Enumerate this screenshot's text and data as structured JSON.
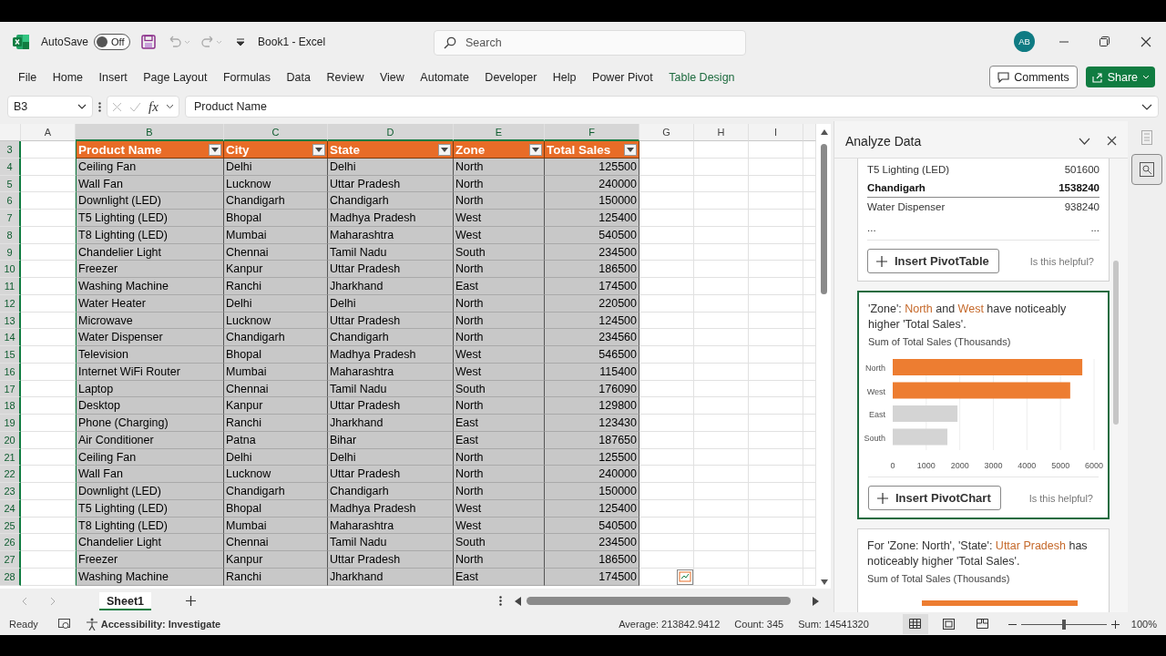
{
  "title_bar": {
    "autosave": {
      "label": "AutoSave",
      "on": false,
      "state_text": "Off"
    },
    "document_title": "Book1  -  Excel",
    "search": {
      "placeholder": "Search"
    },
    "avatar": "AB"
  },
  "ribbon": {
    "tabs": [
      {
        "label": "File",
        "contextual": false
      },
      {
        "label": "Home",
        "contextual": false
      },
      {
        "label": "Insert",
        "contextual": false
      },
      {
        "label": "Page Layout",
        "contextual": false
      },
      {
        "label": "Formulas",
        "contextual": false
      },
      {
        "label": "Data",
        "contextual": false
      },
      {
        "label": "Review",
        "contextual": false
      },
      {
        "label": "View",
        "contextual": false
      },
      {
        "label": "Automate",
        "contextual": false
      },
      {
        "label": "Developer",
        "contextual": false
      },
      {
        "label": "Help",
        "contextual": false
      },
      {
        "label": "Power Pivot",
        "contextual": false
      },
      {
        "label": "Table Design",
        "contextual": true
      }
    ],
    "comments": "Comments",
    "share": "Share"
  },
  "formula_bar": {
    "name_box": "B3",
    "fx": "fx",
    "formula": "Product Name"
  },
  "grid": {
    "columns": [
      {
        "letter": "A",
        "selected": false
      },
      {
        "letter": "B",
        "selected": true
      },
      {
        "letter": "C",
        "selected": true
      },
      {
        "letter": "D",
        "selected": true
      },
      {
        "letter": "E",
        "selected": true
      },
      {
        "letter": "F",
        "selected": true
      },
      {
        "letter": "G",
        "selected": false
      },
      {
        "letter": "H",
        "selected": false
      },
      {
        "letter": "I",
        "selected": false
      }
    ],
    "header_row": {
      "number": "3",
      "selected": true
    },
    "table_columns": [
      {
        "label": "Product Name"
      },
      {
        "label": "City"
      },
      {
        "label": "State"
      },
      {
        "label": "Zone"
      },
      {
        "label": "Total Sales"
      }
    ],
    "rows": [
      {
        "number": "4",
        "selected": true,
        "cells": [
          "Ceiling Fan",
          "Delhi",
          "Delhi",
          "North",
          "125500"
        ]
      },
      {
        "number": "5",
        "selected": true,
        "cells": [
          "Wall Fan",
          "Lucknow",
          "Uttar Pradesh",
          "North",
          "240000"
        ]
      },
      {
        "number": "6",
        "selected": true,
        "cells": [
          "Downlight (LED)",
          "Chandigarh",
          "Chandigarh",
          "North",
          "150000"
        ]
      },
      {
        "number": "7",
        "selected": true,
        "cells": [
          "T5 Lighting (LED)",
          "Bhopal",
          "Madhya Pradesh",
          "West",
          "125400"
        ]
      },
      {
        "number": "8",
        "selected": true,
        "cells": [
          "T8 Lighting (LED)",
          "Mumbai",
          "Maharashtra",
          "West",
          "540500"
        ]
      },
      {
        "number": "9",
        "selected": true,
        "cells": [
          "Chandelier Light",
          "Chennai",
          "Tamil Nadu",
          "South",
          "234500"
        ]
      },
      {
        "number": "10",
        "selected": true,
        "cells": [
          "Freezer",
          "Kanpur",
          "Uttar Pradesh",
          "North",
          "186500"
        ]
      },
      {
        "number": "11",
        "selected": true,
        "cells": [
          "Washing Machine",
          "Ranchi",
          "Jharkhand",
          "East",
          "174500"
        ]
      },
      {
        "number": "12",
        "selected": true,
        "cells": [
          "Water Heater",
          "Delhi",
          "Delhi",
          "North",
          "220500"
        ]
      },
      {
        "number": "13",
        "selected": true,
        "cells": [
          "Microwave",
          "Lucknow",
          "Uttar Pradesh",
          "North",
          "124500"
        ]
      },
      {
        "number": "14",
        "selected": true,
        "cells": [
          "Water Dispenser",
          "Chandigarh",
          "Chandigarh",
          "North",
          "234560"
        ]
      },
      {
        "number": "15",
        "selected": true,
        "cells": [
          "Television",
          "Bhopal",
          "Madhya Pradesh",
          "West",
          "546500"
        ]
      },
      {
        "number": "16",
        "selected": true,
        "cells": [
          "Internet WiFi Router",
          "Mumbai",
          "Maharashtra",
          "West",
          "115400"
        ]
      },
      {
        "number": "17",
        "selected": true,
        "cells": [
          "Laptop",
          "Chennai",
          "Tamil Nadu",
          "South",
          "176090"
        ]
      },
      {
        "number": "18",
        "selected": true,
        "cells": [
          "Desktop",
          "Kanpur",
          "Uttar Pradesh",
          "North",
          "129800"
        ]
      },
      {
        "number": "19",
        "selected": true,
        "cells": [
          "Phone (Charging)",
          "Ranchi",
          "Jharkhand",
          "East",
          "123430"
        ]
      },
      {
        "number": "20",
        "selected": true,
        "cells": [
          "Air Conditioner",
          "Patna",
          "Bihar",
          "East",
          "187650"
        ]
      },
      {
        "number": "21",
        "selected": true,
        "cells": [
          "Ceiling Fan",
          "Delhi",
          "Delhi",
          "North",
          "125500"
        ]
      },
      {
        "number": "22",
        "selected": true,
        "cells": [
          "Wall Fan",
          "Lucknow",
          "Uttar Pradesh",
          "North",
          "240000"
        ]
      },
      {
        "number": "23",
        "selected": true,
        "cells": [
          "Downlight (LED)",
          "Chandigarh",
          "Chandigarh",
          "North",
          "150000"
        ]
      },
      {
        "number": "24",
        "selected": true,
        "cells": [
          "T5 Lighting (LED)",
          "Bhopal",
          "Madhya Pradesh",
          "West",
          "125400"
        ]
      },
      {
        "number": "25",
        "selected": true,
        "cells": [
          "T8 Lighting (LED)",
          "Mumbai",
          "Maharashtra",
          "West",
          "540500"
        ]
      },
      {
        "number": "26",
        "selected": true,
        "cells": [
          "Chandelier Light",
          "Chennai",
          "Tamil Nadu",
          "South",
          "234500"
        ]
      },
      {
        "number": "27",
        "selected": true,
        "cells": [
          "Freezer",
          "Kanpur",
          "Uttar Pradesh",
          "North",
          "186500"
        ]
      },
      {
        "number": "28",
        "selected": true,
        "cells": [
          "Washing Machine",
          "Ranchi",
          "Jharkhand",
          "East",
          "174500"
        ]
      }
    ]
  },
  "sheets": [
    {
      "name": "Sheet1",
      "selected": true
    }
  ],
  "analyze_panel": {
    "title": "Analyze Data",
    "cards": [
      {
        "kind": "table",
        "selected": false,
        "rows": [
          {
            "kind": "item",
            "label": "T5 Lighting (LED)",
            "value": "501600"
          },
          {
            "kind": "group",
            "label": "Chandigarh",
            "value": "1538240"
          },
          {
            "kind": "item",
            "label": "Water Dispenser",
            "value": "938240"
          },
          {
            "kind": "more",
            "label": "...",
            "value": "..."
          }
        ],
        "button": "Insert PivotTable",
        "feedback": "Is this helpful?"
      },
      {
        "kind": "chart",
        "selected": true,
        "headline": [
          {
            "text": "'Zone': ",
            "highlight": false
          },
          {
            "text": "North",
            "highlight": true
          },
          {
            "text": " and ",
            "highlight": false
          },
          {
            "text": "West",
            "highlight": true
          },
          {
            "text": " have noticeably higher 'Total Sales'.",
            "highlight": false
          }
        ],
        "subtitle": "Sum of Total Sales (Thousands)",
        "chart_data": {
          "type": "bar",
          "orientation": "horizontal",
          "grid": true,
          "categories": [
            "North",
            "West",
            "East",
            "South"
          ],
          "values": [
            5650,
            5290,
            1930,
            1630
          ],
          "xlim": [
            0,
            6000
          ],
          "xticks": [
            0,
            1000,
            2000,
            3000,
            4000,
            5000,
            6000
          ]
        },
        "bar_highlights": [
          true,
          true,
          false,
          false
        ],
        "button": "Insert PivotChart",
        "feedback": "Is this helpful?"
      },
      {
        "kind": "chart",
        "selected": false,
        "headline": [
          {
            "text": "For 'Zone: North', 'State': ",
            "highlight": false
          },
          {
            "text": "Uttar Pradesh",
            "highlight": true
          },
          {
            "text": " has noticeably higher 'Total Sales'.",
            "highlight": false
          }
        ],
        "subtitle": "Sum of Total Sales (Thousands)"
      }
    ]
  },
  "status_bar": {
    "mode": "Ready",
    "accessibility": "Accessibility: Investigate",
    "average": "Average: 213842.9412",
    "count": "Count: 345",
    "sum": "Sum: 14541320",
    "views": [
      {
        "kind": "normal",
        "selected": true
      },
      {
        "kind": "page_layout",
        "selected": false
      },
      {
        "kind": "page_break",
        "selected": false
      }
    ],
    "zoom": {
      "level": 0.5,
      "reading": "100%"
    }
  }
}
